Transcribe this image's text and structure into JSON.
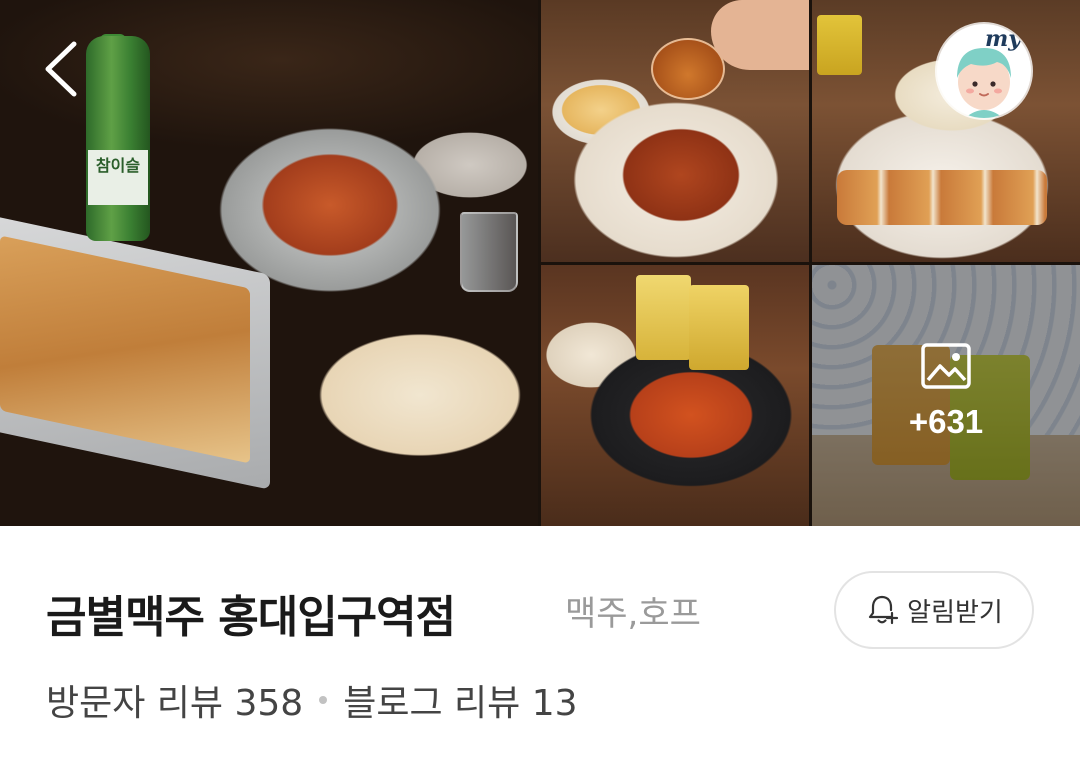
{
  "gallery": {
    "main_photo": {
      "bottle_label": "참이슬"
    },
    "more_photos": {
      "count_label": "+631",
      "icon": "image-icon"
    },
    "back_icon": "chevron-left-icon",
    "avatar": {
      "badge_text": "my",
      "icon": "avatar-icon"
    }
  },
  "place": {
    "name": "금별맥주 홍대입구역점",
    "category": "맥주,호프",
    "notify_button": {
      "label": "알림받기",
      "icon": "bell-plus-icon"
    },
    "reviews": {
      "visitor": "방문자 리뷰 358",
      "blog": "블로그 리뷰 13"
    }
  },
  "colors": {
    "title": "#1a1a1a",
    "category": "#9a9a9a",
    "review_text": "#444444",
    "separator_dot": "#c2c2c2",
    "button_border": "#e3e3e3",
    "avatar_badge_text": "#1f3b5c",
    "avatar_skin": "#f7d9c8",
    "avatar_hair": "#7fd0c6"
  }
}
